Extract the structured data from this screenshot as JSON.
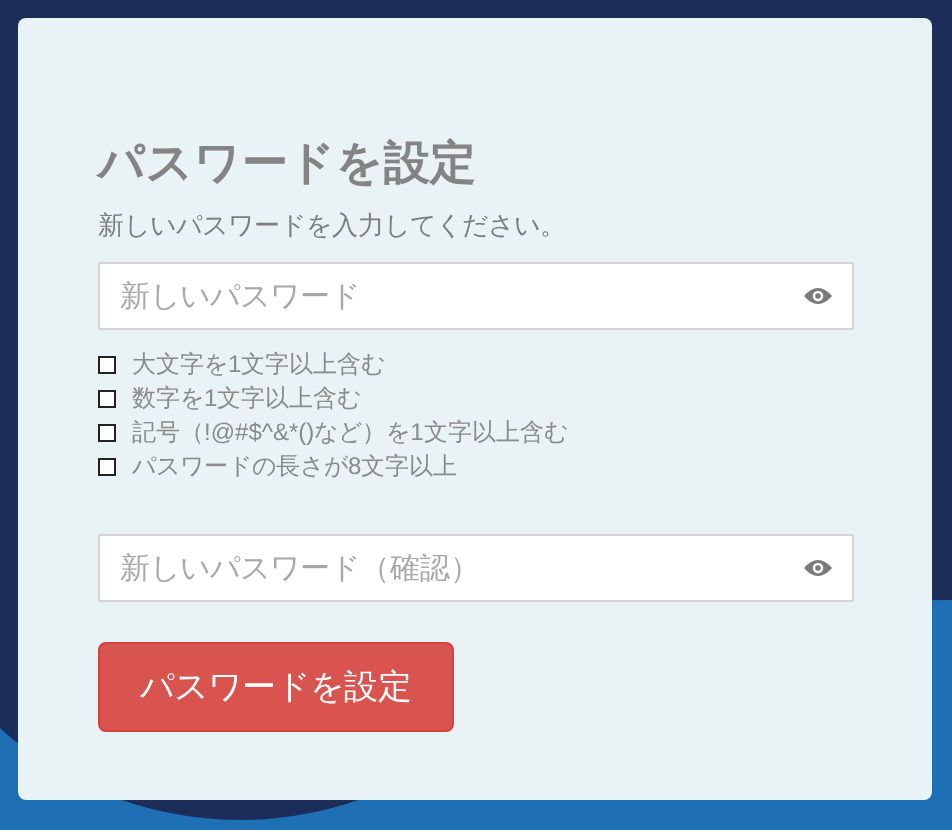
{
  "title": "パスワードを設定",
  "subtitle": "新しいパスワードを入力してください。",
  "password_field": {
    "placeholder": "新しいパスワード"
  },
  "requirements": [
    {
      "label": "大文字を1文字以上含む",
      "checked": false
    },
    {
      "label": "数字を1文字以上含む",
      "checked": false
    },
    {
      "label": "記号（!@#$^&*()など）を1文字以上含む",
      "checked": false
    },
    {
      "label": "パスワードの長さが8文字以上",
      "checked": false
    }
  ],
  "confirm_field": {
    "placeholder": "新しいパスワード（確認）"
  },
  "submit_button": "パスワードを設定"
}
